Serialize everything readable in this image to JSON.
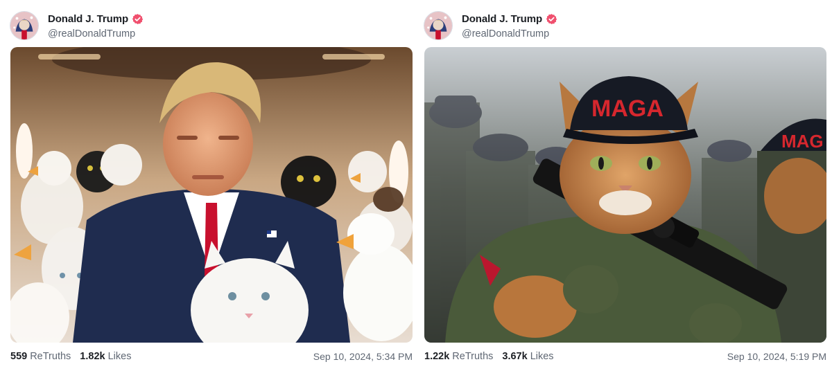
{
  "posts": [
    {
      "author": {
        "display_name": "Donald J. Trump",
        "handle": "@realDonaldTrump",
        "verified_icon": "verified-badge-icon",
        "badge_color": "#f0506e"
      },
      "media": {
        "description_icon": "image-icon"
      },
      "stats": {
        "retruths_count": "559",
        "retruths_label": "ReTruths",
        "likes_count": "1.82k",
        "likes_label": "Likes"
      },
      "timestamp": "Sep 10, 2024, 5:34 PM"
    },
    {
      "author": {
        "display_name": "Donald J. Trump",
        "handle": "@realDonaldTrump",
        "verified_icon": "verified-badge-icon",
        "badge_color": "#f0506e"
      },
      "media": {
        "cap_text": "MAGA",
        "cap_text_secondary": "MAG",
        "description_icon": "image-icon"
      },
      "stats": {
        "retruths_count": "1.22k",
        "retruths_label": "ReTruths",
        "likes_count": "3.67k",
        "likes_label": "Likes"
      },
      "timestamp": "Sep 10, 2024, 5:19 PM"
    }
  ]
}
